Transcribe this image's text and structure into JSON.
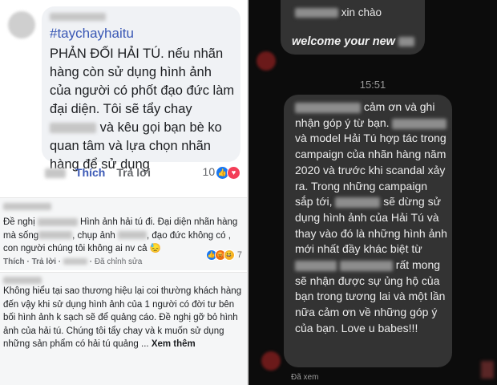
{
  "comments": [
    {
      "hashtag": "#taychayhaitu",
      "text_parts": [
        "PHẢN ĐỐI HẢI TÚ.  nếu nhãn hàng còn sử dụng hình ảnh của người có phốt đạo đức làm đại diện.  Tôi sẽ tẩy chay ",
        " và kêu gọi bạn bè ko quan tâm và lựa chọn nhãn hàng để sử dụng"
      ],
      "like_label": "Thích",
      "reply_label": "Trả lời",
      "reaction_count": "10"
    },
    {
      "text_parts": [
        "Đề nghị ",
        " Hình ảnh hải tú đi. Đại diện nhãn hàng mà sống",
        ", chụp ảnh ",
        ", đạo đức không có , con người chúng tôi không ai nv cả 😓"
      ],
      "like_label": "Thích",
      "reply_label": "Trả lời",
      "edited_label": "Đã chỉnh sửa",
      "reaction_count": "7"
    },
    {
      "text": "Không hiểu tại sao thương hiệu lại coi thường khách hàng đến vậy khi sử dụng hình ảnh của 1 người có đời tư bên bối hình ảnh k sạch sẽ để quảng cáo. Đề nghị gỡ bỏ hình ảnh của hải tú. Chúng tôi tẩy chay và k muốn sử dụng những sản phẩm có hải tú quảng ...",
      "see_more": "Xem thêm"
    }
  ],
  "chat": {
    "first_message": {
      "line1": "xin chào",
      "line2": "welcome your new"
    },
    "timestamp": "15:51",
    "reply_parts": [
      " cảm ơn và ghi nhận góp ý từ bạn.",
      " và model Hải Tú hợp tác trong campaign của nhãn hàng năm 2020 và trước khi scandal xảy ra. Trong những campaign sắp tới, ",
      " sẽ dừng sử dụng hình ảnh của Hải Tú và thay vào đó là những hình ảnh mới nhất đầy khác biệt từ ",
      " rất mong sẽ nhận được sự ủng hộ của bạn trong tương lai và một lần nữa cảm ơn về những góp ý của bạn. Love u babes!!!"
    ],
    "seen_label": "Đã xem"
  }
}
